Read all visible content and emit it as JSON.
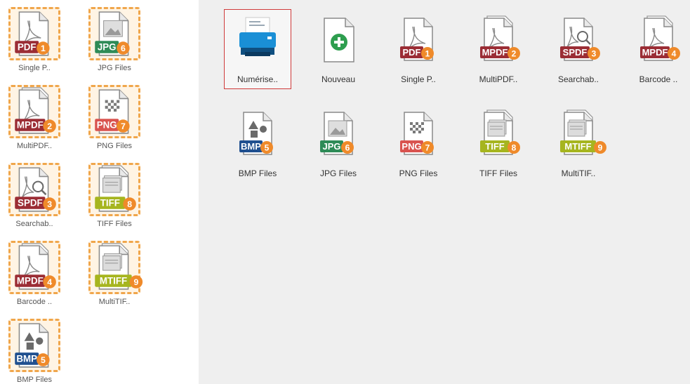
{
  "sidebar": {
    "items": [
      {
        "icon": "pdf-file-icon",
        "badge": "PDF",
        "number": "1",
        "color": "#9b2d35",
        "glyph": "acrobat",
        "label": "Single P.."
      },
      {
        "icon": "jpg-file-icon",
        "badge": "JPG",
        "number": "6",
        "color": "#2e8b57",
        "glyph": "image",
        "label": "JPG Files"
      },
      {
        "icon": "mpdf-file-icon",
        "badge": "MPDF",
        "number": "2",
        "color": "#9b2d35",
        "glyph": "acrobat-multi",
        "label": "MultiPDF.."
      },
      {
        "icon": "png-file-icon",
        "badge": "PNG",
        "number": "7",
        "color": "#d9534f",
        "glyph": "checker",
        "label": "PNG Files"
      },
      {
        "icon": "spdf-file-icon",
        "badge": "SPDF",
        "number": "3",
        "color": "#9b2d35",
        "glyph": "acrobat-search",
        "label": "Searchab.."
      },
      {
        "icon": "tiff-file-icon",
        "badge": "TIFF",
        "number": "8",
        "color": "#a6b51f",
        "glyph": "image-multi",
        "label": "TIFF Files"
      },
      {
        "icon": "barcode-mpdf-file-icon",
        "badge": "MPDF",
        "number": "4",
        "color": "#9b2d35",
        "glyph": "acrobat-multi",
        "label": "Barcode .."
      },
      {
        "icon": "mtiff-file-icon",
        "badge": "MTIFF",
        "number": "9",
        "color": "#a6b51f",
        "glyph": "image-multi",
        "label": "MultiTIF.."
      },
      {
        "icon": "bmp-file-icon",
        "badge": "BMP",
        "number": "5",
        "color": "#1f4f8f",
        "glyph": "shapes",
        "label": "BMP Files"
      }
    ]
  },
  "main": {
    "scanner": {
      "label": "Numérise.."
    },
    "new": {
      "label": "Nouveau"
    },
    "tiles": [
      {
        "icon": "pdf-file-icon",
        "badge": "PDF",
        "number": "1",
        "color": "#9b2d35",
        "glyph": "acrobat",
        "label": "Single P.."
      },
      {
        "icon": "mpdf-file-icon",
        "badge": "MPDF",
        "number": "2",
        "color": "#9b2d35",
        "glyph": "acrobat-multi",
        "label": "MultiPDF.."
      },
      {
        "icon": "spdf-file-icon",
        "badge": "SPDF",
        "number": "3",
        "color": "#9b2d35",
        "glyph": "acrobat-search",
        "label": "Searchab.."
      },
      {
        "icon": "barcode-mpdf-file-icon",
        "badge": "MPDF",
        "number": "4",
        "color": "#9b2d35",
        "glyph": "acrobat-multi",
        "label": "Barcode .."
      },
      {
        "icon": "bmp-file-icon",
        "badge": "BMP",
        "number": "5",
        "color": "#1f4f8f",
        "glyph": "shapes",
        "label": "BMP Files"
      },
      {
        "icon": "jpg-file-icon",
        "badge": "JPG",
        "number": "6",
        "color": "#2e8b57",
        "glyph": "image",
        "label": "JPG Files"
      },
      {
        "icon": "png-file-icon",
        "badge": "PNG",
        "number": "7",
        "color": "#d9534f",
        "glyph": "checker",
        "label": "PNG Files"
      },
      {
        "icon": "tiff-file-icon",
        "badge": "TIFF",
        "number": "8",
        "color": "#a6b51f",
        "glyph": "image-multi",
        "label": "TIFF Files"
      },
      {
        "icon": "mtiff-file-icon",
        "badge": "MTIFF",
        "number": "9",
        "color": "#a6b51f",
        "glyph": "image-multi",
        "label": "MultiTIF.."
      }
    ]
  },
  "colors": {
    "number_badge": "#ef8a2a",
    "frame": "#f0a64b",
    "selection": "#cf3a3a",
    "scanner_blue": "#1a8fd6",
    "new_green": "#2e9e4f"
  }
}
